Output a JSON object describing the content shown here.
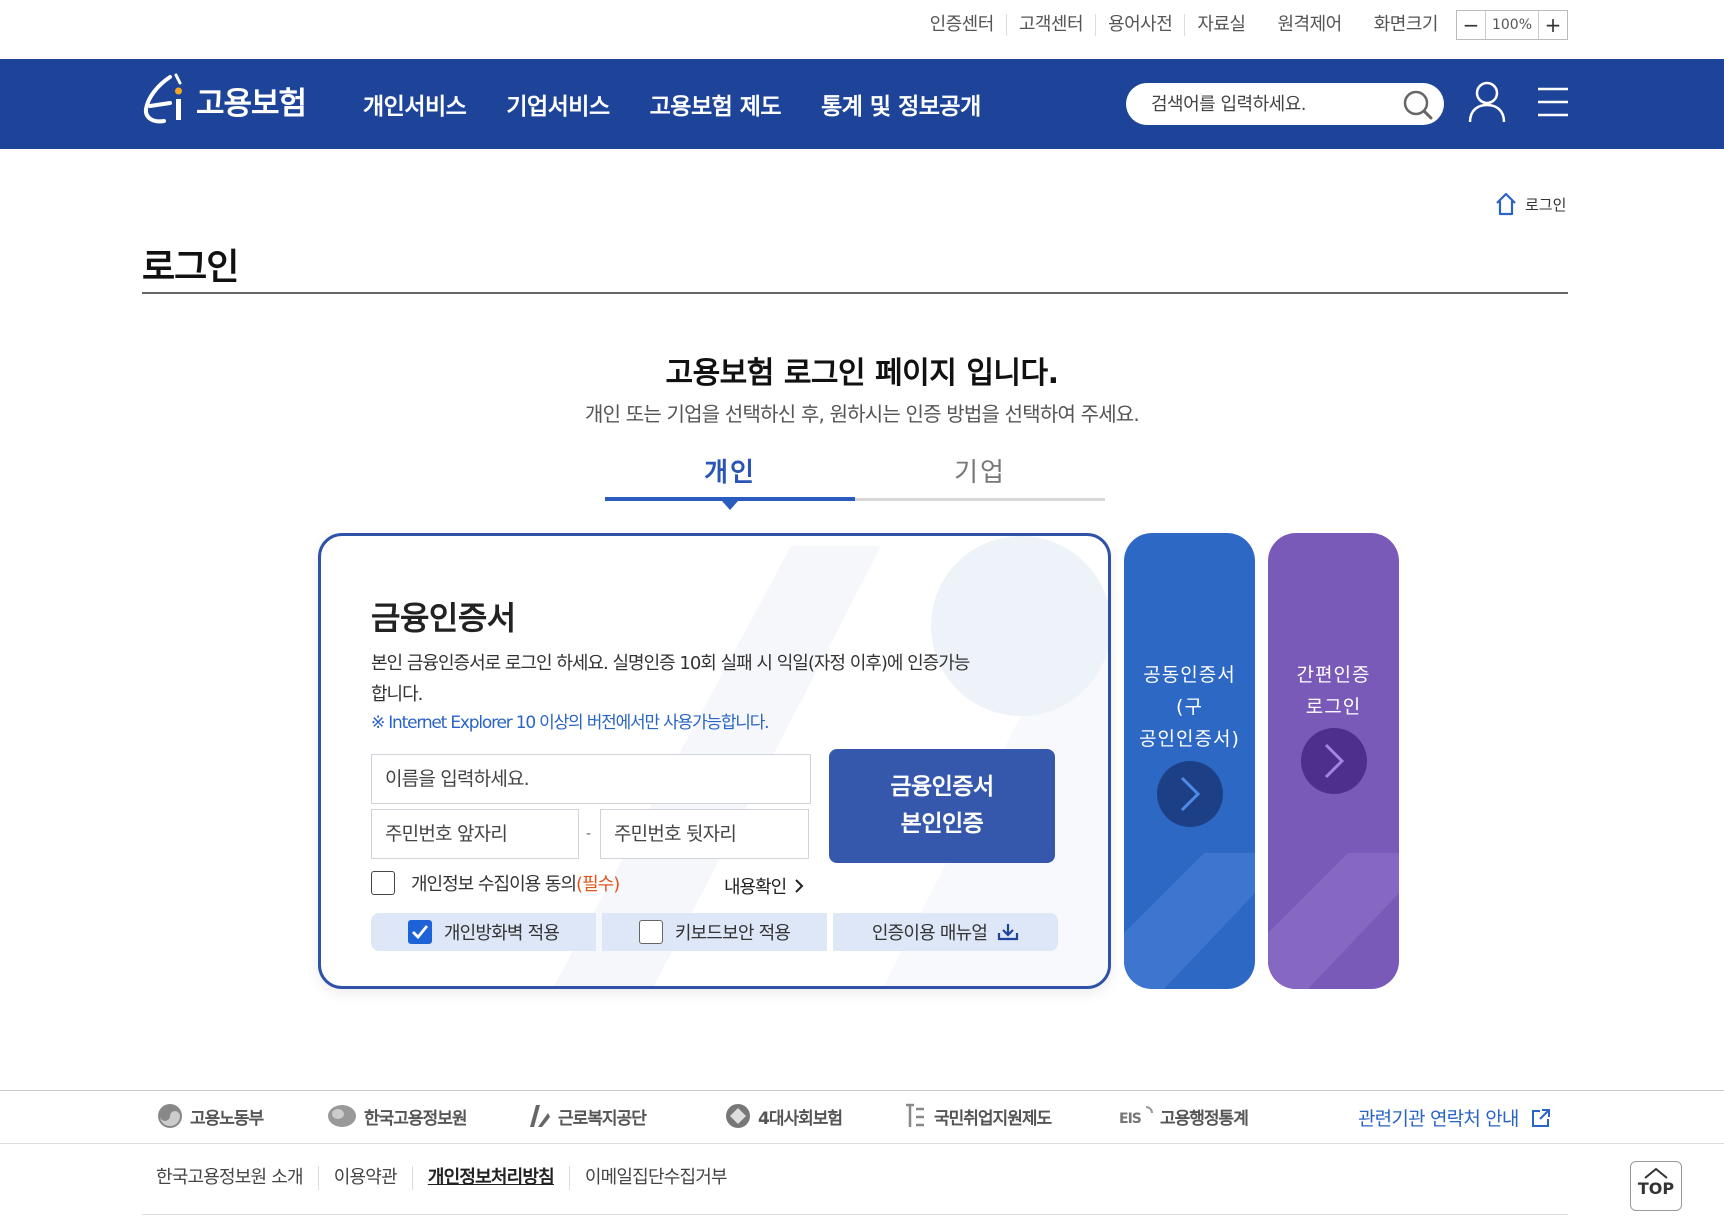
{
  "utility": {
    "links": [
      "인증센터",
      "고객센터",
      "용어사전",
      "자료실",
      "원격제어"
    ],
    "screen_size_label": "화면크기",
    "zoom_minus": "−",
    "zoom_value": "100%",
    "zoom_plus": "+"
  },
  "header": {
    "logo_text": "고용보험",
    "menu": [
      "개인서비스",
      "기업서비스",
      "고용보험 제도",
      "통계 및 정보공개"
    ],
    "search_placeholder": "검색어를 입력하세요."
  },
  "breadcrumb": {
    "label": "로그인"
  },
  "page": {
    "title": "로그인",
    "headline": "고용보험 로그인 페이지 입니다.",
    "subtitle": "개인 또는 기업을 선택하신 후, 원하시는 인증 방법을 선택하여 주세요."
  },
  "tabs": [
    {
      "label": "개인",
      "active": true
    },
    {
      "label": "기업",
      "active": false
    }
  ],
  "card": {
    "title": "금융인증서",
    "desc": "본인 금융인증서로 로그인 하세요. 실명인증 10회 실패 시 익일(자정 이후)에 인증가능합니다.",
    "note": "※ Internet Explorer 10 이상의 버전에서만 사용가능합니다.",
    "name_placeholder": "이름을 입력하세요.",
    "rrn_front_placeholder": "주민번호 앞자리",
    "rrn_dash": "-",
    "rrn_back_placeholder": "주민번호 뒷자리",
    "auth_button_line1": "금융인증서",
    "auth_button_line2": "본인인증",
    "agree_label": "개인정보 수집이용 동의",
    "agree_required": "(필수)",
    "confirm_label": "내용확인",
    "options": [
      {
        "label": "개인방화벽 적용",
        "checked": true
      },
      {
        "label": "키보드보안 적용",
        "checked": false
      },
      {
        "label": "인증이용 매뉴얼"
      }
    ]
  },
  "side_pills": {
    "joint_cert": {
      "line1": "공동인증서",
      "line2": "(구",
      "line3": "공인인증서)",
      "color": "#2e68c5"
    },
    "simple_auth": {
      "line1": "간편인증",
      "line2": "로그인",
      "color": "#7a5ab8"
    }
  },
  "footer": {
    "orgs": [
      "고용노동부",
      "한국고용정보원",
      "근로복지공단",
      "4대사회보험",
      "국민취업지원제도",
      "고용행정통계"
    ],
    "related_link": "관련기관 연락처 안내",
    "links": [
      "한국고용정보원 소개",
      "이용약관",
      "개인정보처리방침",
      "이메일집단수집거부"
    ],
    "top_button": "TOP"
  },
  "colors": {
    "brand": "#1e4499",
    "accent": "#2a5cbf",
    "required": "#e0561d"
  }
}
